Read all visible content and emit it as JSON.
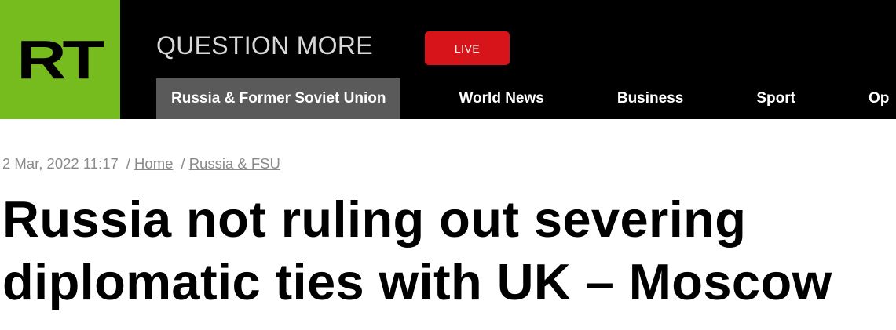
{
  "header": {
    "logo_text": "RT",
    "tagline": "QUESTION MORE",
    "live_label": "LIVE",
    "colors": {
      "logo_bg": "#77bc1f",
      "header_bg": "#000000",
      "live_bg": "#d8141b",
      "active_nav_bg": "#5a5a5a"
    }
  },
  "nav": {
    "items": [
      {
        "label": "Russia & Former Soviet Union",
        "active": true
      },
      {
        "label": "World News"
      },
      {
        "label": "Business"
      },
      {
        "label": "Sport"
      },
      {
        "label": "Op"
      }
    ]
  },
  "article": {
    "date": "2 Mar, 2022 11:17",
    "separator": "/",
    "breadcrumbs": [
      "Home",
      "Russia & FSU"
    ],
    "headline": "Russia not ruling out severing diplomatic ties with UK – Moscow"
  }
}
